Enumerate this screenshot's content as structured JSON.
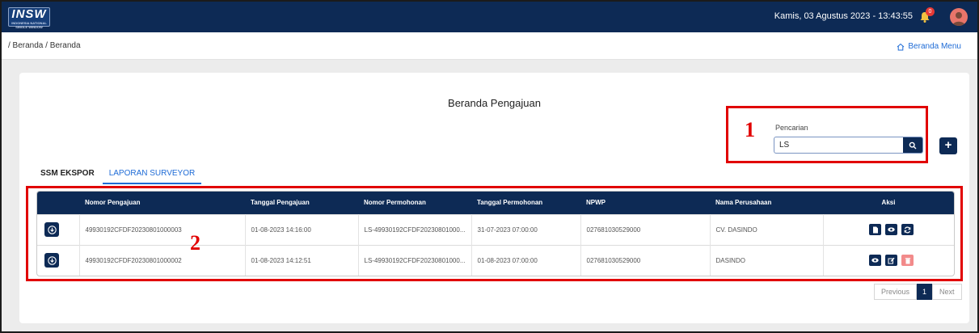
{
  "header": {
    "logo_text": "INSW",
    "logo_subtext": "INDONESIA NATIONAL SINGLE WINDOW",
    "datetime": "Kamis, 03 Agustus 2023 - 13:43:55",
    "notification_count": "0"
  },
  "breadcrumb": {
    "path": "/ Beranda / Beranda",
    "menu_label": "Beranda Menu"
  },
  "page": {
    "title": "Beranda Pengajuan"
  },
  "search": {
    "label": "Pencarian",
    "value": "LS",
    "add_label": "+"
  },
  "tabs": [
    "SSM EKSPOR",
    "LAPORAN SURVEYOR"
  ],
  "table": {
    "columns": [
      "",
      "Nomor Pengajuan",
      "Tanggal Pengajuan",
      "Nomor Permohonan",
      "Tanggal Permohonan",
      "NPWP",
      "Nama Perusahaan",
      "Aksi"
    ],
    "rows": [
      {
        "nomor_pengajuan": "49930192CFDF20230801000003",
        "tanggal_pengajuan": "01-08-2023 14:16:00",
        "nomor_permohonan": "LS-49930192CFDF20230801000...",
        "tanggal_permohonan": "31-07-2023 07:00:00",
        "npwp": "027681030529000",
        "nama_perusahaan": "CV. DASINDO",
        "actions": [
          "document-icon",
          "eye-icon",
          "refresh-icon"
        ]
      },
      {
        "nomor_pengajuan": "49930192CFDF20230801000002",
        "tanggal_pengajuan": "01-08-2023 14:12:51",
        "nomor_permohonan": "LS-49930192CFDF20230801000...",
        "tanggal_permohonan": "01-08-2023 07:00:00",
        "npwp": "027681030529000",
        "nama_perusahaan": "DASINDO",
        "actions": [
          "eye-icon",
          "edit-icon",
          "trash-icon"
        ]
      }
    ]
  },
  "pagination": {
    "previous": "Previous",
    "current": "1",
    "next": "Next"
  },
  "annotations": {
    "label_1": "1",
    "label_2": "2"
  },
  "colors": {
    "navy": "#0d2a55",
    "accent_blue": "#1e6bd6",
    "annotation_red": "#e10000",
    "danger": "#f28a8a"
  }
}
